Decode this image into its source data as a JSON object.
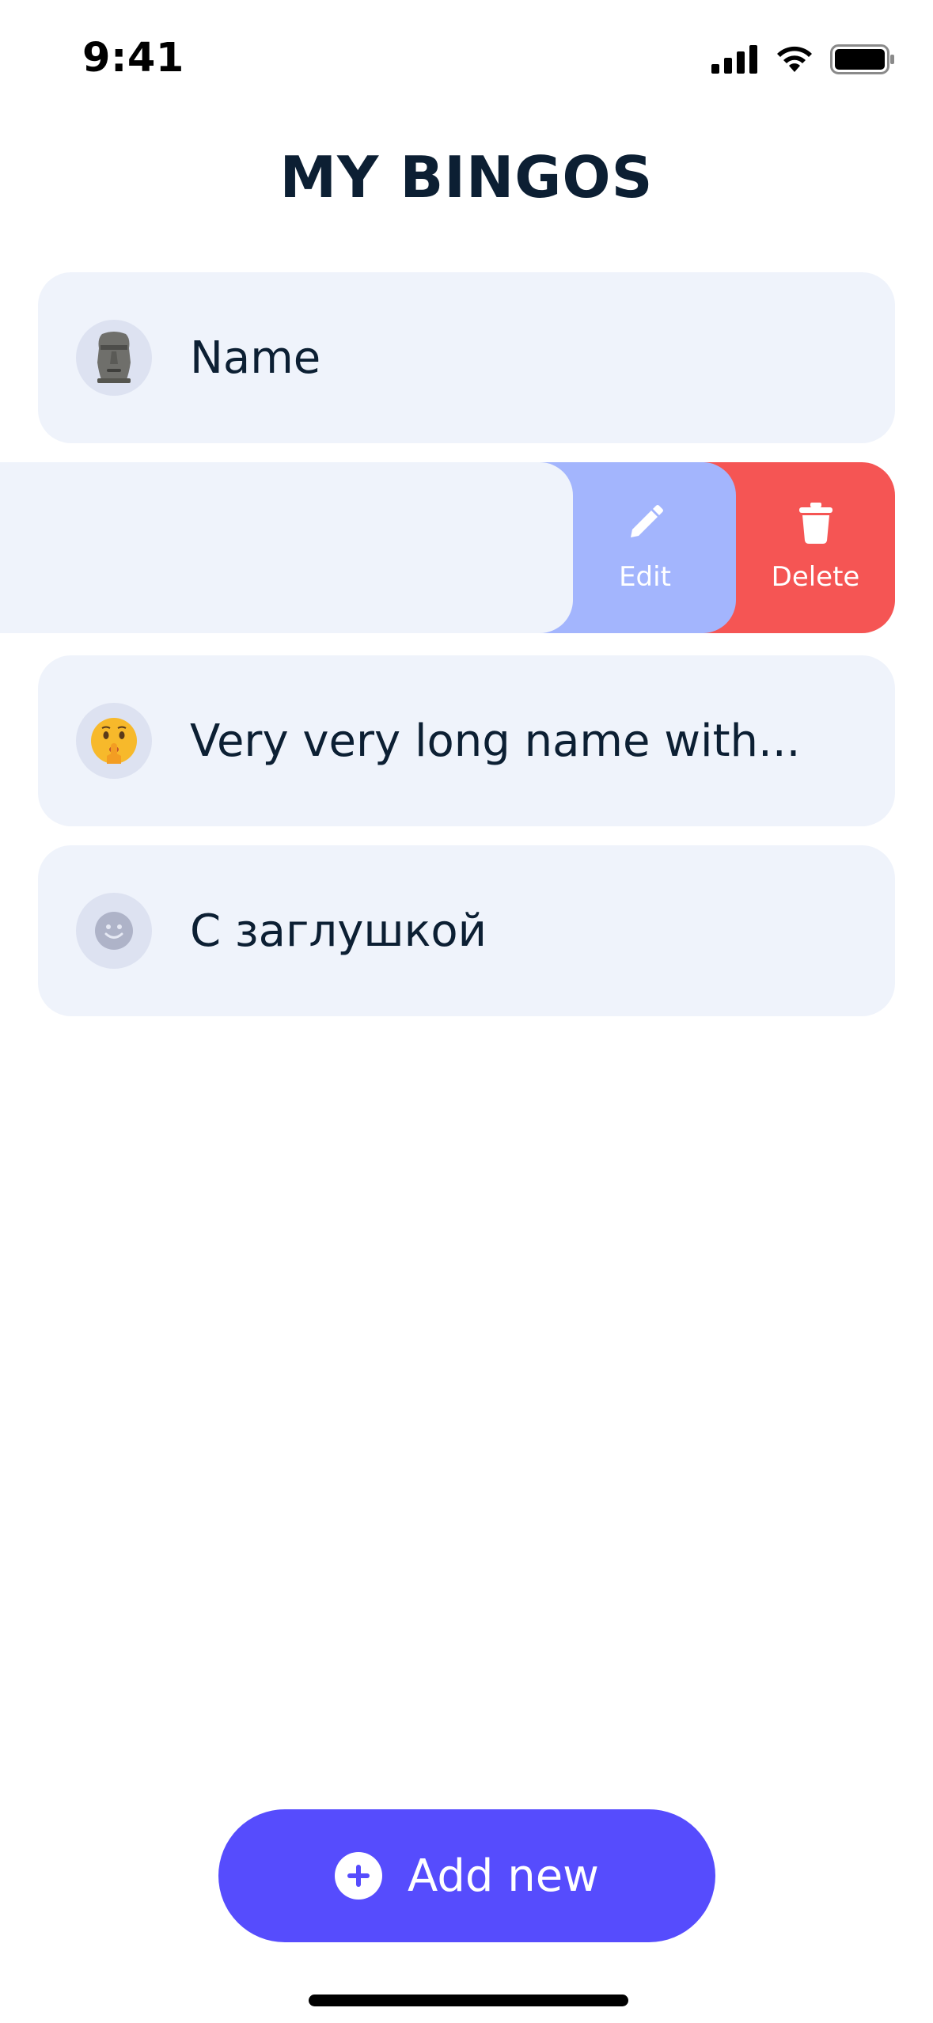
{
  "status_bar": {
    "time": "9:41"
  },
  "header": {
    "title": "MY BINGOS"
  },
  "bingos": [
    {
      "name": "Name",
      "icon": "moai-emoji-icon"
    },
    {
      "name": "",
      "icon": ""
    },
    {
      "name": "Very very long name with...",
      "icon": "shushing-face-emoji-icon"
    },
    {
      "name": "С заглушкой",
      "icon": "placeholder-smile-icon"
    }
  ],
  "swipe_actions": {
    "edit_label": "Edit",
    "delete_label": "Delete"
  },
  "add_button": {
    "label": "Add new"
  },
  "colors": {
    "primary": "#564cfd",
    "edit": "#a3b5fd",
    "delete": "#f55554",
    "card": "#eff3fb",
    "text": "#0c1f33"
  }
}
